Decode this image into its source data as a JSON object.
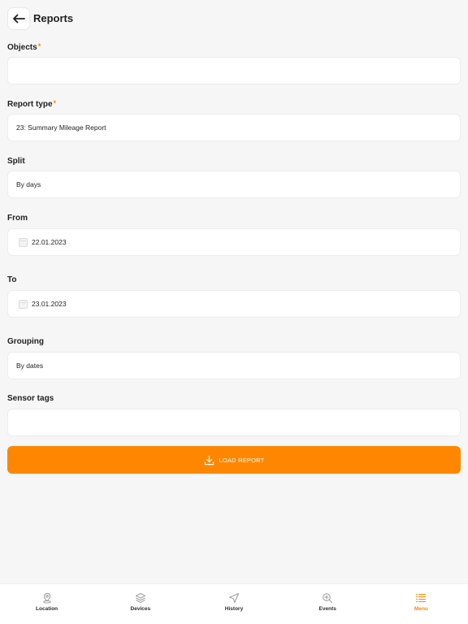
{
  "header": {
    "title": "Reports"
  },
  "colors": {
    "accent": "#ff8600",
    "background": "#f6f6f6",
    "field_bg": "#ffffff",
    "text": "#1f1f1f"
  },
  "form": {
    "objects": {
      "label": "Objects",
      "required": "*",
      "value": ""
    },
    "report_type": {
      "label": "Report type",
      "required": "*",
      "value": "23: Summary Mileage Report"
    },
    "split": {
      "label": "Split",
      "value": "By days"
    },
    "from": {
      "label": "From",
      "value": "22.01.2023",
      "icon": "calendar-icon"
    },
    "to": {
      "label": "To",
      "value": "23.01.2023",
      "icon": "calendar-icon"
    },
    "grouping": {
      "label": "Grouping",
      "value": "By dates"
    },
    "sensor_tags": {
      "label": "Sensor tags",
      "value": ""
    },
    "load_button": {
      "label": "LOAD REPORT",
      "icon": "download-icon"
    }
  },
  "tabbar": {
    "tabs": [
      {
        "label": "Location",
        "icon": "location-pin-icon",
        "active": false
      },
      {
        "label": "Devices",
        "icon": "layers-icon",
        "active": false
      },
      {
        "label": "History",
        "icon": "navigation-arrow-icon",
        "active": false
      },
      {
        "label": "Events",
        "icon": "zoom-plus-icon",
        "active": false
      },
      {
        "label": "Menu",
        "icon": "list-menu-icon",
        "active": true
      }
    ]
  }
}
